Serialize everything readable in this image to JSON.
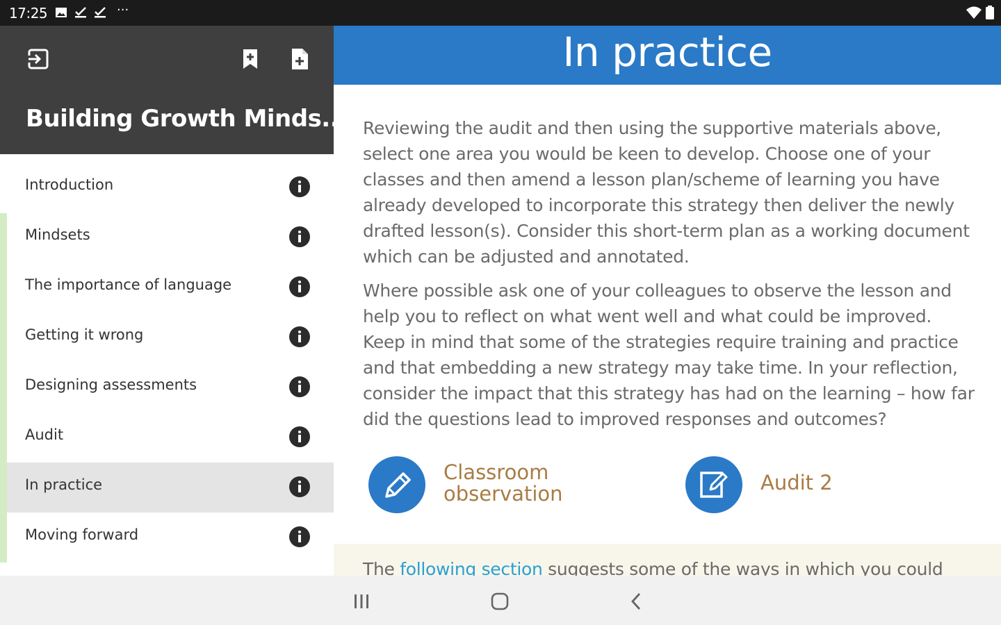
{
  "status_bar": {
    "time": "17:25",
    "icons": [
      "image-icon",
      "download-done-icon",
      "download-done-icon",
      "wifi-icon",
      "battery-icon"
    ],
    "more": "···"
  },
  "sidebar": {
    "title": "Building Growth Minds...",
    "header_icons": [
      "exit-icon",
      "bookmark-add-icon",
      "note-add-icon"
    ],
    "items": [
      {
        "label": "Introduction",
        "active": false
      },
      {
        "label": "Mindsets",
        "active": false
      },
      {
        "label": "The importance of language",
        "active": false
      },
      {
        "label": "Getting it wrong",
        "active": false
      },
      {
        "label": "Designing assessments",
        "active": false
      },
      {
        "label": "Audit",
        "active": false
      },
      {
        "label": "In practice",
        "active": true
      },
      {
        "label": "Moving forward",
        "active": false
      }
    ]
  },
  "content": {
    "title": "In practice",
    "paragraphs": [
      "Reviewing the audit and then using the supportive materials above, select one area you would be keen to develop. Choose one of your classes and then amend a lesson plan/scheme of learning you have already developed to incorporate this strategy then deliver the newly drafted lesson(s). Consider this short-term plan as a working document which can be adjusted and annotated.",
      "Where possible ask one of your colleagues to observe the lesson and help you to reflect on what went well and what could be improved. Keep in mind that some of the strategies require training and practice and that embedding a new strategy may take time. In your reflection, consider the impact that this strategy has had on the learning – how far did the questions lead to improved responses and outcomes?"
    ],
    "links": [
      {
        "label_line1": "Classroom",
        "label_line2": "observation",
        "icon": "pencil-icon"
      },
      {
        "label": "Audit 2",
        "icon": "edit-document-icon"
      }
    ],
    "notice": {
      "text_before": "The ",
      "link": "following section",
      "text_after": " suggests some of the ways in which you could"
    }
  },
  "colors": {
    "accent": "#2a7ac7",
    "sidebar_header": "#3f3f3f",
    "link_label": "#a97c44",
    "progress_rail": "#d4ecc4"
  },
  "nav_bar": {
    "buttons": [
      "recents-icon",
      "home-icon",
      "back-icon"
    ]
  }
}
